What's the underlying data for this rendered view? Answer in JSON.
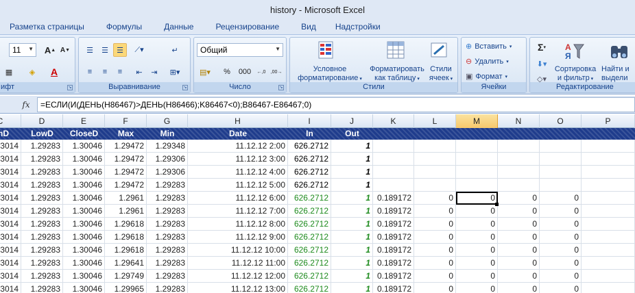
{
  "window": {
    "title": "history - Microsoft Excel"
  },
  "tabs": [
    "Разметка страницы",
    "Формулы",
    "Данные",
    "Рецензирование",
    "Вид",
    "Надстройки"
  ],
  "ribbon": {
    "font": {
      "size": "11",
      "label": "ифт"
    },
    "alignment": {
      "label": "Выравнивание"
    },
    "number": {
      "format": "Общий",
      "label": "Число",
      "percent": "%",
      "thousands": "000",
      "inc_decimal": ",0\n,00",
      "dec_decimal": ",00\n,0"
    },
    "styles": {
      "label": "Стили",
      "conditional": "Условное\nформатирование",
      "as_table": "Форматировать\nкак таблицу",
      "cell_styles": "Стили\nячеек"
    },
    "cells": {
      "label": "Ячейки",
      "insert": "Вставить",
      "delete": "Удалить",
      "format": "Формат"
    },
    "editing": {
      "label": "Редактирование",
      "sort_filter": "Сортировка\nи фильтр",
      "find": "Найти и\nвыдели",
      "sum_icon": "Σ"
    }
  },
  "formula_bar": {
    "fx": "fx",
    "formula": "=ЕСЛИ(И(ДЕНЬ(H86467)>ДЕНЬ(H86466);K86467<0);B86467-E86467;0)"
  },
  "columns": [
    "C",
    "D",
    "E",
    "F",
    "G",
    "H",
    "I",
    "J",
    "K",
    "L",
    "M",
    "N",
    "O",
    "P"
  ],
  "selected_column": "M",
  "data_headers": [
    "hD",
    "LowD",
    "CloseD",
    "Max",
    "Min",
    "Date",
    "In",
    "Out",
    "",
    "",
    "",
    "",
    "",
    ""
  ],
  "rows": [
    {
      "c": "3014",
      "d": "1.29283",
      "e": "1.30046",
      "f": "1.29472",
      "g": "1.29348",
      "h": "11.12.12 2:00",
      "i": "626.2712",
      "j": "1",
      "k": "",
      "l": "",
      "m": "",
      "n": "",
      "o": "",
      "green": false
    },
    {
      "c": "3014",
      "d": "1.29283",
      "e": "1.30046",
      "f": "1.29472",
      "g": "1.29306",
      "h": "11.12.12 3:00",
      "i": "626.2712",
      "j": "1",
      "k": "",
      "l": "",
      "m": "",
      "n": "",
      "o": "",
      "green": false
    },
    {
      "c": "3014",
      "d": "1.29283",
      "e": "1.30046",
      "f": "1.29472",
      "g": "1.29306",
      "h": "11.12.12 4:00",
      "i": "626.2712",
      "j": "1",
      "k": "",
      "l": "",
      "m": "",
      "n": "",
      "o": "",
      "green": false
    },
    {
      "c": "3014",
      "d": "1.29283",
      "e": "1.30046",
      "f": "1.29472",
      "g": "1.29283",
      "h": "11.12.12 5:00",
      "i": "626.2712",
      "j": "1",
      "k": "",
      "l": "",
      "m": "",
      "n": "",
      "o": "",
      "green": false
    },
    {
      "c": "3014",
      "d": "1.29283",
      "e": "1.30046",
      "f": "1.2961",
      "g": "1.29283",
      "h": "11.12.12 6:00",
      "i": "626.2712",
      "j": "1",
      "k": "0.189172",
      "l": "0",
      "m": "0",
      "n": "0",
      "o": "0",
      "green": true
    },
    {
      "c": "3014",
      "d": "1.29283",
      "e": "1.30046",
      "f": "1.2961",
      "g": "1.29283",
      "h": "11.12.12 7:00",
      "i": "626.2712",
      "j": "1",
      "k": "0.189172",
      "l": "0",
      "m": "0",
      "n": "0",
      "o": "0",
      "green": true
    },
    {
      "c": "3014",
      "d": "1.29283",
      "e": "1.30046",
      "f": "1.29618",
      "g": "1.29283",
      "h": "11.12.12 8:00",
      "i": "626.2712",
      "j": "1",
      "k": "0.189172",
      "l": "0",
      "m": "0",
      "n": "0",
      "o": "0",
      "green": true
    },
    {
      "c": "3014",
      "d": "1.29283",
      "e": "1.30046",
      "f": "1.29618",
      "g": "1.29283",
      "h": "11.12.12 9:00",
      "i": "626.2712",
      "j": "1",
      "k": "0.189172",
      "l": "0",
      "m": "0",
      "n": "0",
      "o": "0",
      "green": true
    },
    {
      "c": "3014",
      "d": "1.29283",
      "e": "1.30046",
      "f": "1.29618",
      "g": "1.29283",
      "h": "11.12.12 10:00",
      "i": "626.2712",
      "j": "1",
      "k": "0.189172",
      "l": "0",
      "m": "0",
      "n": "0",
      "o": "0",
      "green": true
    },
    {
      "c": "3014",
      "d": "1.29283",
      "e": "1.30046",
      "f": "1.29641",
      "g": "1.29283",
      "h": "11.12.12 11:00",
      "i": "626.2712",
      "j": "1",
      "k": "0.189172",
      "l": "0",
      "m": "0",
      "n": "0",
      "o": "0",
      "green": true
    },
    {
      "c": "3014",
      "d": "1.29283",
      "e": "1.30046",
      "f": "1.29749",
      "g": "1.29283",
      "h": "11.12.12 12:00",
      "i": "626.2712",
      "j": "1",
      "k": "0.189172",
      "l": "0",
      "m": "0",
      "n": "0",
      "o": "0",
      "green": true
    },
    {
      "c": "3014",
      "d": "1.29283",
      "e": "1.30046",
      "f": "1.29965",
      "g": "1.29283",
      "h": "11.12.12 13:00",
      "i": "626.2712",
      "j": "1",
      "k": "0.189172",
      "l": "0",
      "m": "0",
      "n": "0",
      "o": "0",
      "green": true
    }
  ],
  "active_cell": {
    "row": 4,
    "col": "m"
  },
  "colors": {
    "header_band": "#1f3c8c",
    "green_text": "#1d8a1d",
    "ribbon_text": "#15428b"
  }
}
